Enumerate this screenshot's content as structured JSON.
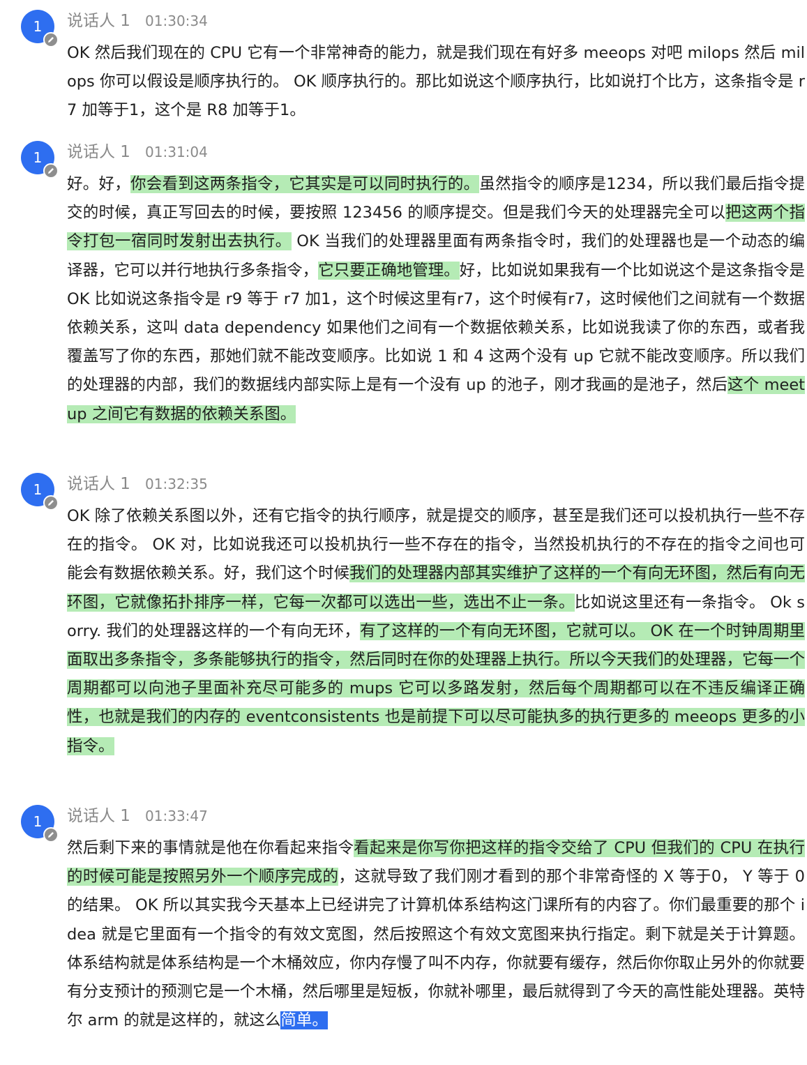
{
  "transcript": {
    "colors": {
      "avatar": "#2e6ef0",
      "highlight": "#b5ebb5",
      "selection": "#2e6ef0",
      "meta_text": "#8a8a8a"
    },
    "entries": [
      {
        "avatar_label": "1",
        "speaker": "说话人 1",
        "time": "01:30:34",
        "segments": [
          {
            "text": "OK 然后我们现在的 CPU 它有一个非常神奇的能力，就是我们现在有好多 meeops 对吧 milops 然后 milops 你可以假设是顺序执行的。 OK 顺序执行的。那比如说这个顺序执行，比如说打个比方，这条指令是 r7 加等于1，这个是 R8 加等于1。",
            "style": "plain"
          }
        ]
      },
      {
        "avatar_label": "1",
        "speaker": "说话人 1",
        "time": "01:31:04",
        "segments": [
          {
            "text": "好。好，",
            "style": "plain"
          },
          {
            "text": "你会看到这两条指令，它其实是可以同时执行的。",
            "style": "hl"
          },
          {
            "text": "虽然指令的顺序是1234，所以我们最后指令提交的时候，真正写回去的时候，要按照 123456 的顺序提交。但是我们今天的处理器完全可以",
            "style": "plain"
          },
          {
            "text": "把这两个指令打包一宿同时发射出去执行。",
            "style": "hl"
          },
          {
            "text": " OK 当我们的处理器里面有两条指令时，我们的处理器也是一个动态的编译器，它可以并行地执行多条指令，",
            "style": "plain"
          },
          {
            "text": "它只要正确地管理。",
            "style": "hl"
          },
          {
            "text": "好，比如说如果我有一个比如说这个是这条指令是 OK 比如说这条指令是 r9 等于 r7 加1，这个时候这里有r7，这个时候有r7，这时候他们之间就有一个数据依赖关系，这叫 data dependency 如果他们之间有一个数据依赖关系，比如说我读了你的东西，或者我覆盖写了你的东西，那她们就不能改变顺序。比如说 1 和 4 这两个没有 up 它就不能改变顺序。所以我们的处理器的内部，我们的数据线内部实际上是有一个没有 up 的池子，刚才我画的是池子，然后",
            "style": "plain"
          },
          {
            "text": "这个 meet up 之间它有数据的依赖关系图。",
            "style": "hl"
          }
        ]
      },
      {
        "avatar_label": "1",
        "speaker": "说话人 1",
        "time": "01:32:35",
        "segments": [
          {
            "text": "OK 除了依赖关系图以外，还有它指令的执行顺序，就是提交的顺序，甚至是我们还可以投机执行一些不存在的指令。 OK 对，比如说我还可以投机执行一些不存在的指令，当然投机执行的不存在的指令之间也可能会有数据依赖关系。好，我们这个时候",
            "style": "plain"
          },
          {
            "text": "我们的处理器内部其实维护了这样的一个有向无环图，然后有向无环图，它就像拓扑排序一样，它每一次都可以选出一些，选出不止一条。",
            "style": "hl"
          },
          {
            "text": "比如说这里还有一条指令。 Ok sorry. 我们的处理器这样的一个有向无环，",
            "style": "plain"
          },
          {
            "text": "有了这样的一个有向无环图，它就可以。 OK 在一个时钟周期里面取出多条指令，多条能够执行的指令，然后同时在你的处理器上执行。所以今天我们的处理器，它每一个周期都可以向池子里面补充尽可能多的 mups 它可以多路发射，然后每个周期都可以在不违反编译正确性，也就是我们的内存的 eventconsistents 也是前提下可以尽可能执多的执行更多的 meeops 更多的小指令。",
            "style": "hl"
          }
        ]
      },
      {
        "avatar_label": "1",
        "speaker": "说话人 1",
        "time": "01:33:47",
        "segments": [
          {
            "text": "然后剩下来的事情就是他在你看起来指令",
            "style": "plain"
          },
          {
            "text": "看起来是你写你把这样的指令交给了 CPU 但我们的 CPU 在执行的时候可能是按照另外一个顺序完成的",
            "style": "hl"
          },
          {
            "text": "，这就导致了我们刚才看到的那个非常奇怪的 X 等于0， Y 等于 0 的结果。 OK 所以其实我今天基本上已经讲完了计算机体系结构这门课所有的内容了。你们最重要的那个 idea 就是它里面有一个指令的有效文宽图，然后按照这个有效文宽图来执行指定。剩下就是关于计算题。体系结构就是体系结构是一个木桶效应，你内存慢了叫不内存，你就要有缓存，然后你你取止另外的你就要有分支预计的预测它是一个木桶，然后哪里是短板，你就补哪里，最后就得到了今天的高性能处理器。英特尔 arm 的就是这样的，就这么",
            "style": "plain"
          },
          {
            "text": "简单。",
            "style": "sel"
          }
        ]
      }
    ]
  }
}
